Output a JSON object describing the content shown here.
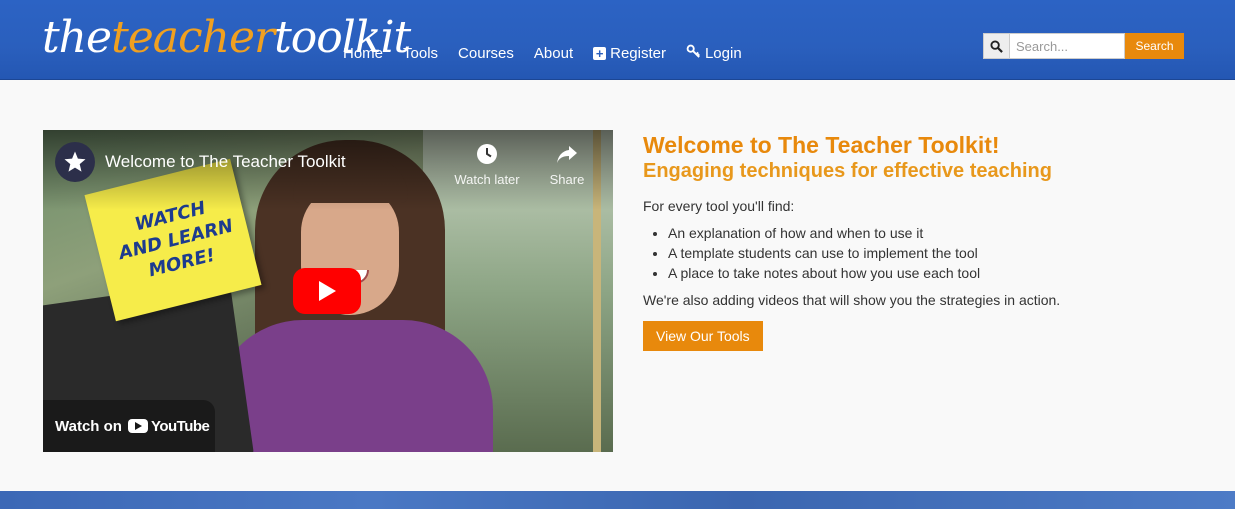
{
  "header": {
    "logo": {
      "part1": "the",
      "part2": "teacher",
      "part3": "toolkit"
    },
    "nav": [
      {
        "label": "Home"
      },
      {
        "label": "Tools"
      },
      {
        "label": "Courses"
      },
      {
        "label": "About"
      },
      {
        "label": "Register",
        "icon": "plus-square-icon"
      },
      {
        "label": "Login",
        "icon": "key-icon"
      }
    ],
    "search": {
      "placeholder": "Search...",
      "button_label": "Search",
      "icon": "search-icon"
    }
  },
  "video": {
    "title": "Welcome to The Teacher Toolkit",
    "sticky_note": "WATCH AND LEARN MORE!",
    "watch_later": "Watch later",
    "share": "Share",
    "watch_on": "Watch on",
    "platform": "YouTube"
  },
  "main": {
    "heading": "Welcome to The Teacher Toolkit!",
    "subheading": "Engaging techniques for effective teaching",
    "intro": "For every tool you'll find:",
    "features": [
      "An explanation of how and when to use it",
      "A template students can use to implement the tool",
      "A place to take notes about how you use each tool"
    ],
    "videos_note": "We're also adding videos that will show you the strategies in action.",
    "cta_label": "View Our Tools"
  },
  "colors": {
    "header_blue": "#2a5fbd",
    "accent_orange": "#e8890c",
    "youtube_red": "#ff0000"
  }
}
